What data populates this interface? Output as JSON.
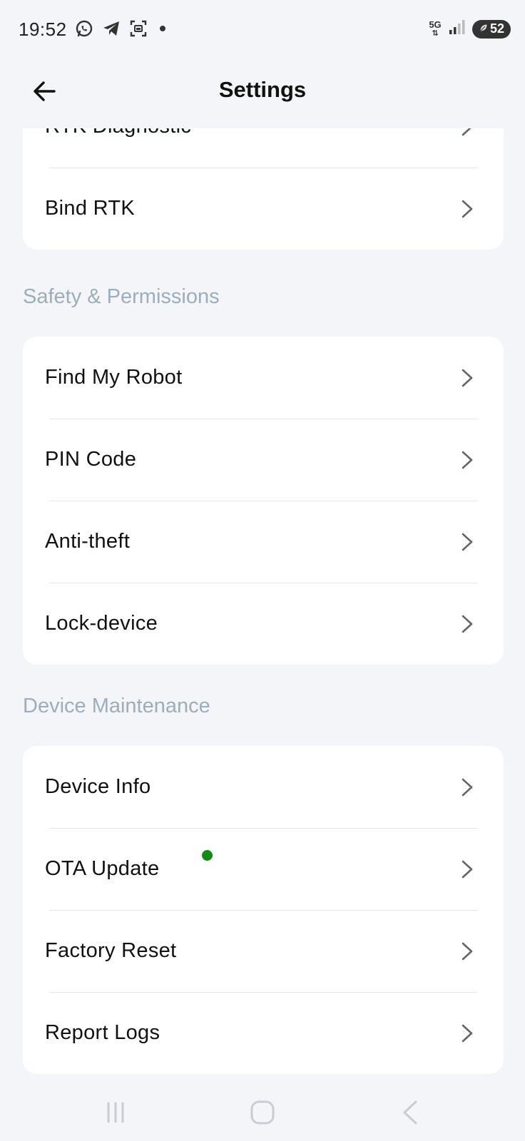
{
  "status_bar": {
    "time": "19:52",
    "network_type": "5G",
    "battery": "52",
    "icons": [
      "whatsapp-icon",
      "telegram-icon",
      "screenshot-icon",
      "notification-dot",
      "signal-icon",
      "battery-saver-icon"
    ]
  },
  "header": {
    "title": "Settings",
    "back_icon": "arrow-left-icon"
  },
  "sections": {
    "rtk": {
      "items": [
        {
          "label": "RTK Diagnostic"
        },
        {
          "label": "Bind RTK"
        }
      ]
    },
    "safety": {
      "title": "Safety & Permissions",
      "items": [
        {
          "label": "Find My Robot"
        },
        {
          "label": "PIN Code"
        },
        {
          "label": "Anti-theft"
        },
        {
          "label": "Lock-device"
        }
      ]
    },
    "maintenance": {
      "title": "Device Maintenance",
      "items": [
        {
          "label": "Device Info"
        },
        {
          "label": "OTA Update",
          "badge": "new-update-dot"
        },
        {
          "label": "Factory Reset"
        },
        {
          "label": "Report Logs"
        }
      ]
    }
  },
  "colors": {
    "background": "#f3f5f9",
    "card": "#ffffff",
    "section_header": "#9eadba",
    "update_dot": "#138a16",
    "chevron": "#666666"
  },
  "nav_bar": {
    "icons": [
      "recent-apps-icon",
      "home-icon",
      "back-icon"
    ]
  }
}
